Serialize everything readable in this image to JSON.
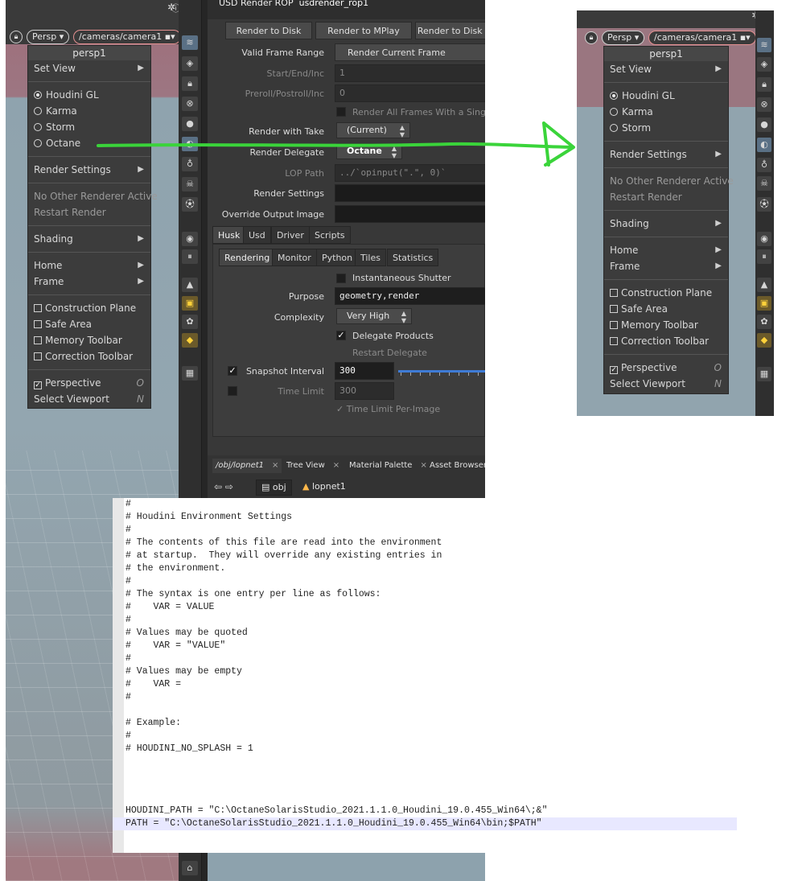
{
  "viewport": {
    "persp_label": "Persp",
    "camera_path": "/cameras/camera1",
    "tools_icons": "gear-icon help-icon"
  },
  "viewport_menu": {
    "title": "persp1",
    "set_view": "Set View",
    "renderers": [
      {
        "label": "Houdini GL",
        "selected": true
      },
      {
        "label": "Karma",
        "selected": false
      },
      {
        "label": "Storm",
        "selected": false
      },
      {
        "label": "Octane",
        "selected": false
      }
    ],
    "render_settings": "Render Settings",
    "no_other_renderer": "No Other Renderer Active",
    "restart_render": "Restart Render",
    "shading": "Shading",
    "home": "Home",
    "frame": "Frame",
    "toggles": [
      {
        "label": "Construction Plane",
        "checked": false
      },
      {
        "label": "Safe Area",
        "checked": false
      },
      {
        "label": "Memory Toolbar",
        "checked": false
      },
      {
        "label": "Correction Toolbar",
        "checked": false
      }
    ],
    "perspective": "Perspective",
    "perspective_key": "O",
    "select_viewport": "Select Viewport",
    "select_viewport_key": "N"
  },
  "right_menu": {
    "renderers": [
      {
        "label": "Houdini GL",
        "selected": true
      },
      {
        "label": "Karma",
        "selected": false
      },
      {
        "label": "Storm",
        "selected": false
      }
    ]
  },
  "render_panel": {
    "node_type": "USD Render ROP",
    "node_name": "usdrender_rop1",
    "buttons": [
      "Render to Disk",
      "Render to MPlay",
      "Render to Disk in"
    ],
    "valid_frame_range_label": "Valid Frame Range",
    "valid_frame_range_value": "Render Current Frame",
    "start_end_inc_label": "Start/End/Inc",
    "start_end_inc_value": "1",
    "preroll_label": "Preroll/Postroll/Inc",
    "preroll_value": "0",
    "render_all_frames": "Render All Frames With a Single Pro",
    "render_with_take_label": "Render with Take",
    "render_with_take_value": "(Current)",
    "render_delegate_label": "Render Delegate",
    "render_delegate_value": "Octane",
    "lop_path_label": "LOP Path",
    "lop_path_value": "../`opinput(\".\", 0)`",
    "render_settings_label": "Render Settings",
    "override_output_label": "Override Output Image",
    "main_tabs": [
      "Husk",
      "Usd",
      "Driver",
      "Scripts"
    ],
    "sub_tabs": [
      "Rendering",
      "Monitor",
      "Python",
      "Tiles",
      "Statistics"
    ],
    "instantaneous_shutter": "Instantaneous Shutter",
    "purpose_label": "Purpose",
    "purpose_value": "geometry,render",
    "complexity_label": "Complexity",
    "complexity_value": "Very High",
    "delegate_products": "Delegate Products",
    "restart_delegate": "Restart Delegate",
    "snapshot_interval_label": "Snapshot Interval",
    "snapshot_interval_value": "300",
    "time_limit_label": "Time Limit",
    "time_limit_value": "300",
    "time_limit_per_image": "Time Limit Per-Image"
  },
  "network_bar": {
    "tabs": [
      "/obj/lopnet1",
      "Tree View",
      "Material Palette",
      "Asset Browser"
    ],
    "path_obj": "obj",
    "path_lopnet": "lopnet1"
  },
  "editor": {
    "lines": [
      "#",
      "# Houdini Environment Settings",
      "#",
      "# The contents of this file are read into the environment",
      "# at startup.  They will override any existing entries in",
      "# the environment.",
      "#",
      "# The syntax is one entry per line as follows:",
      "#    VAR = VALUE",
      "#",
      "# Values may be quoted",
      "#    VAR = \"VALUE\"",
      "#",
      "# Values may be empty",
      "#    VAR =",
      "#",
      "",
      "# Example:",
      "#",
      "# HOUDINI_NO_SPLASH = 1"
    ],
    "houdini_path_line": "HOUDINI_PATH = \"C:\\OctaneSolarisStudio_2021.1.1.0_Houdini_19.0.455_Win64\\;&\"",
    "path_line": "PATH = \"C:\\OctaneSolarisStudio_2021.1.1.0_Houdini_19.0.455_Win64\\bin;$PATH\""
  },
  "colors": {
    "arrow": "#3ad43a",
    "cam_pill_border": "#e49090",
    "slider": "#3e7bd6"
  }
}
